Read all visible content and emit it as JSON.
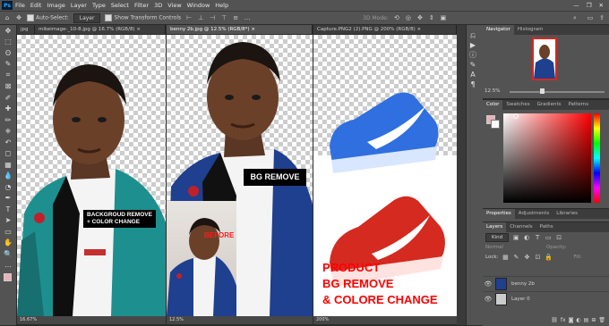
{
  "app": {
    "logo": "Ps",
    "icon": "photoshop-logo"
  },
  "menu": [
    "File",
    "Edit",
    "Image",
    "Layer",
    "Type",
    "Select",
    "Filter",
    "3D",
    "View",
    "Window",
    "Help"
  ],
  "window_controls": [
    "—",
    "❐",
    "✕"
  ],
  "options": {
    "auto_select_label": "Auto-Select:",
    "auto_select_value": "Layer",
    "transform_label": "Show Transform Controls",
    "mode_label": "3D Mode:"
  },
  "tools": [
    "move-icon",
    "marquee-icon",
    "lasso-icon",
    "quick-select-icon",
    "crop-icon",
    "frame-icon",
    "eyedropper-icon",
    "heal-icon",
    "brush-icon",
    "stamp-icon",
    "history-brush-icon",
    "eraser-icon",
    "gradient-icon",
    "blur-icon",
    "dodge-icon",
    "pen-icon",
    "type-icon",
    "path-select-icon",
    "rectangle-icon",
    "hand-icon",
    "zoom-icon",
    "more-icon"
  ],
  "tool_glyphs": [
    "✥",
    "⬚",
    "ʘ",
    "✎",
    "⌗",
    "⊠",
    "✐",
    "✚",
    "✏",
    "⎈",
    "↶",
    "◻",
    "▦",
    "💧",
    "◔",
    "✒",
    "T",
    "➤",
    "▭",
    "✋",
    "🔍",
    "…"
  ],
  "docs": [
    {
      "tab": "jpg",
      "zoom": ""
    },
    {
      "tab": "mikeimage-_10-8.jpg @ 16.7% (RGB/8) ×",
      "zoom": "16.67%"
    },
    {
      "tab": "benny 2b.jpg @ 12.5% (RGB/8*) ×",
      "zoom": "12.5%"
    },
    {
      "tab": "Capture.PNG2 (2).PNG @ 200% (RGB/8) ×",
      "zoom": "200%"
    }
  ],
  "overlay_text": {
    "bg_remove_color_line1": "BACKGROUD REMOVE",
    "bg_remove_color_line2": "+ COLOR CHANGE",
    "bg_remove": "BG REMOVE",
    "before": "BEFORE",
    "product_line1": "PRODUCT",
    "product_line2": "BG REMOVE",
    "product_line3": "& COLORE CHANGE"
  },
  "navigator": {
    "tabs": [
      "Navigator",
      "Histogram"
    ],
    "zoom": "12.5%"
  },
  "color_panel": {
    "tabs": [
      "Color",
      "Swatches",
      "Gradients",
      "Patterns"
    ]
  },
  "properties": {
    "tabs": [
      "Properties",
      "Adjustments",
      "Libraries"
    ]
  },
  "layers": {
    "tabs": [
      "Layers",
      "Channels",
      "Paths"
    ],
    "filter": "Kind",
    "blend": "Normal",
    "opacity_label": "Opacity:",
    "lock_label": "Lock:",
    "fill_label": "Fill:",
    "rows": [
      "benny 2b",
      "Layer 0"
    ]
  },
  "colors": {
    "accent_red": "#ff0000",
    "ui_bg": "#535353",
    "ui_dark": "#3c3c3c"
  }
}
